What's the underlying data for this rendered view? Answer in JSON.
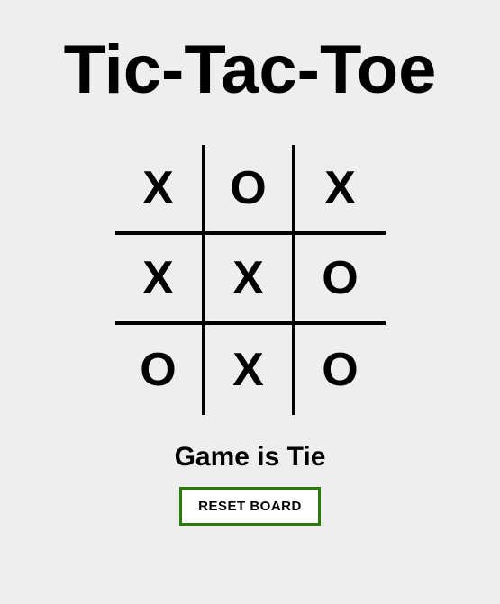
{
  "title": "Tic-Tac-Toe",
  "board": {
    "cells": [
      "X",
      "O",
      "X",
      "X",
      "X",
      "O",
      "O",
      "X",
      "O"
    ]
  },
  "status": "Game is Tie",
  "reset_label": "RESET BOARD"
}
